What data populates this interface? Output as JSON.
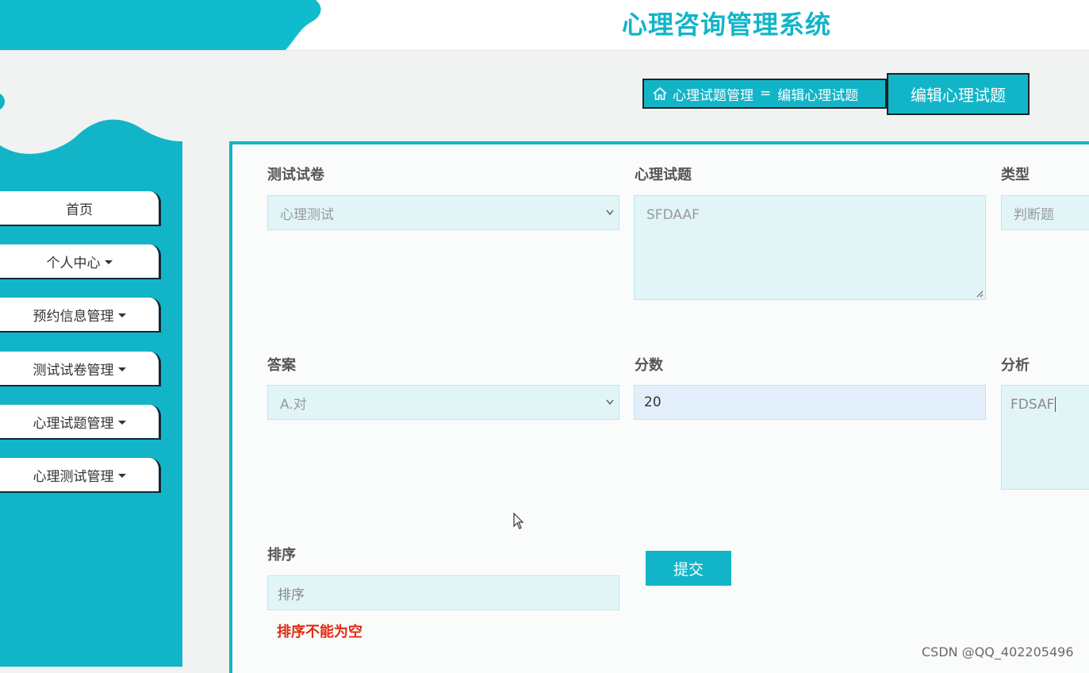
{
  "app": {
    "title": "心理咨询管理系统",
    "brand_color": "#12b5c8",
    "header_blob_color": "#0fbccd",
    "sidebar_color": "#12b5c8"
  },
  "sidebar": {
    "items": [
      {
        "label": "首页",
        "has_dropdown": false
      },
      {
        "label": "个人中心",
        "has_dropdown": true
      },
      {
        "label": "预约信息管理",
        "has_dropdown": true
      },
      {
        "label": "测试试卷管理",
        "has_dropdown": true
      },
      {
        "label": "心理试题管理",
        "has_dropdown": true
      },
      {
        "label": "心理测试管理",
        "has_dropdown": true
      }
    ]
  },
  "breadcrumb": {
    "icon": "home-icon",
    "parent": "心理试题管理",
    "separator": "=",
    "current": "编辑心理试题"
  },
  "page_badge": "编辑心理试题",
  "form": {
    "paper": {
      "label": "测试试卷",
      "value": "心理测试"
    },
    "question": {
      "label": "心理试题",
      "value": "SFDAAF"
    },
    "type": {
      "label": "类型",
      "value": "判断题"
    },
    "answer": {
      "label": "答案",
      "value": "A.对"
    },
    "score": {
      "label": "分数",
      "value": "20"
    },
    "analysis": {
      "label": "分析",
      "value": "FDSAF"
    },
    "sort": {
      "label": "排序",
      "placeholder": "排序",
      "error": "排序不能为空"
    },
    "submit_label": "提交"
  },
  "watermark": "CSDN @QQ_402205496"
}
